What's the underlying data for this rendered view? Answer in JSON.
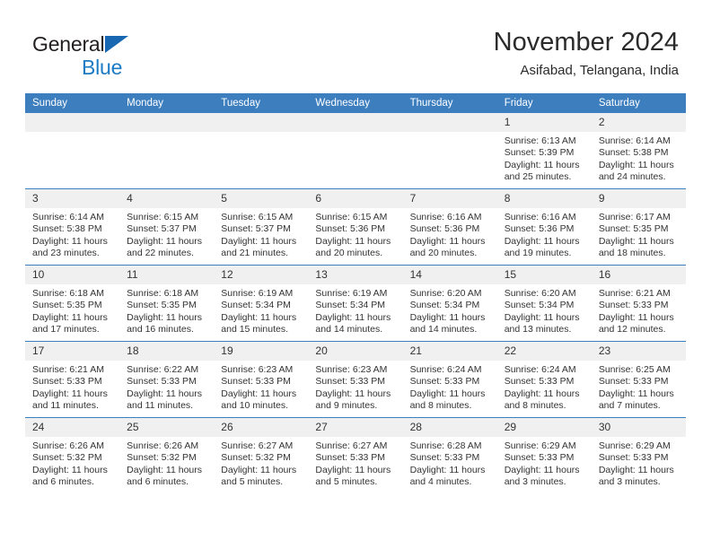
{
  "brand": {
    "word1": "General",
    "word2": "Blue",
    "triangle_color": "#1767b2",
    "blue_color": "#1b7ac4"
  },
  "header": {
    "title": "November 2024",
    "subtitle": "Asifabad, Telangana, India"
  },
  "theme": {
    "header_blue": "#3d7ebf",
    "daynum_gray": "#f0f0f0",
    "text": "#333333"
  },
  "weekday_headers": [
    "Sunday",
    "Monday",
    "Tuesday",
    "Wednesday",
    "Thursday",
    "Friday",
    "Saturday"
  ],
  "labels": {
    "sunrise": "Sunrise:",
    "sunset": "Sunset:",
    "daylight": "Daylight:"
  },
  "weeks": [
    [
      {
        "day": "",
        "empty": true
      },
      {
        "day": "",
        "empty": true
      },
      {
        "day": "",
        "empty": true
      },
      {
        "day": "",
        "empty": true
      },
      {
        "day": "",
        "empty": true
      },
      {
        "day": "1",
        "sunrise": "Sunrise: 6:13 AM",
        "sunset": "Sunset: 5:39 PM",
        "daylight": "Daylight: 11 hours and 25 minutes."
      },
      {
        "day": "2",
        "sunrise": "Sunrise: 6:14 AM",
        "sunset": "Sunset: 5:38 PM",
        "daylight": "Daylight: 11 hours and 24 minutes."
      }
    ],
    [
      {
        "day": "3",
        "sunrise": "Sunrise: 6:14 AM",
        "sunset": "Sunset: 5:38 PM",
        "daylight": "Daylight: 11 hours and 23 minutes."
      },
      {
        "day": "4",
        "sunrise": "Sunrise: 6:15 AM",
        "sunset": "Sunset: 5:37 PM",
        "daylight": "Daylight: 11 hours and 22 minutes."
      },
      {
        "day": "5",
        "sunrise": "Sunrise: 6:15 AM",
        "sunset": "Sunset: 5:37 PM",
        "daylight": "Daylight: 11 hours and 21 minutes."
      },
      {
        "day": "6",
        "sunrise": "Sunrise: 6:15 AM",
        "sunset": "Sunset: 5:36 PM",
        "daylight": "Daylight: 11 hours and 20 minutes."
      },
      {
        "day": "7",
        "sunrise": "Sunrise: 6:16 AM",
        "sunset": "Sunset: 5:36 PM",
        "daylight": "Daylight: 11 hours and 20 minutes."
      },
      {
        "day": "8",
        "sunrise": "Sunrise: 6:16 AM",
        "sunset": "Sunset: 5:36 PM",
        "daylight": "Daylight: 11 hours and 19 minutes."
      },
      {
        "day": "9",
        "sunrise": "Sunrise: 6:17 AM",
        "sunset": "Sunset: 5:35 PM",
        "daylight": "Daylight: 11 hours and 18 minutes."
      }
    ],
    [
      {
        "day": "10",
        "sunrise": "Sunrise: 6:18 AM",
        "sunset": "Sunset: 5:35 PM",
        "daylight": "Daylight: 11 hours and 17 minutes."
      },
      {
        "day": "11",
        "sunrise": "Sunrise: 6:18 AM",
        "sunset": "Sunset: 5:35 PM",
        "daylight": "Daylight: 11 hours and 16 minutes."
      },
      {
        "day": "12",
        "sunrise": "Sunrise: 6:19 AM",
        "sunset": "Sunset: 5:34 PM",
        "daylight": "Daylight: 11 hours and 15 minutes."
      },
      {
        "day": "13",
        "sunrise": "Sunrise: 6:19 AM",
        "sunset": "Sunset: 5:34 PM",
        "daylight": "Daylight: 11 hours and 14 minutes."
      },
      {
        "day": "14",
        "sunrise": "Sunrise: 6:20 AM",
        "sunset": "Sunset: 5:34 PM",
        "daylight": "Daylight: 11 hours and 14 minutes."
      },
      {
        "day": "15",
        "sunrise": "Sunrise: 6:20 AM",
        "sunset": "Sunset: 5:34 PM",
        "daylight": "Daylight: 11 hours and 13 minutes."
      },
      {
        "day": "16",
        "sunrise": "Sunrise: 6:21 AM",
        "sunset": "Sunset: 5:33 PM",
        "daylight": "Daylight: 11 hours and 12 minutes."
      }
    ],
    [
      {
        "day": "17",
        "sunrise": "Sunrise: 6:21 AM",
        "sunset": "Sunset: 5:33 PM",
        "daylight": "Daylight: 11 hours and 11 minutes."
      },
      {
        "day": "18",
        "sunrise": "Sunrise: 6:22 AM",
        "sunset": "Sunset: 5:33 PM",
        "daylight": "Daylight: 11 hours and 11 minutes."
      },
      {
        "day": "19",
        "sunrise": "Sunrise: 6:23 AM",
        "sunset": "Sunset: 5:33 PM",
        "daylight": "Daylight: 11 hours and 10 minutes."
      },
      {
        "day": "20",
        "sunrise": "Sunrise: 6:23 AM",
        "sunset": "Sunset: 5:33 PM",
        "daylight": "Daylight: 11 hours and 9 minutes."
      },
      {
        "day": "21",
        "sunrise": "Sunrise: 6:24 AM",
        "sunset": "Sunset: 5:33 PM",
        "daylight": "Daylight: 11 hours and 8 minutes."
      },
      {
        "day": "22",
        "sunrise": "Sunrise: 6:24 AM",
        "sunset": "Sunset: 5:33 PM",
        "daylight": "Daylight: 11 hours and 8 minutes."
      },
      {
        "day": "23",
        "sunrise": "Sunrise: 6:25 AM",
        "sunset": "Sunset: 5:33 PM",
        "daylight": "Daylight: 11 hours and 7 minutes."
      }
    ],
    [
      {
        "day": "24",
        "sunrise": "Sunrise: 6:26 AM",
        "sunset": "Sunset: 5:32 PM",
        "daylight": "Daylight: 11 hours and 6 minutes."
      },
      {
        "day": "25",
        "sunrise": "Sunrise: 6:26 AM",
        "sunset": "Sunset: 5:32 PM",
        "daylight": "Daylight: 11 hours and 6 minutes."
      },
      {
        "day": "26",
        "sunrise": "Sunrise: 6:27 AM",
        "sunset": "Sunset: 5:32 PM",
        "daylight": "Daylight: 11 hours and 5 minutes."
      },
      {
        "day": "27",
        "sunrise": "Sunrise: 6:27 AM",
        "sunset": "Sunset: 5:33 PM",
        "daylight": "Daylight: 11 hours and 5 minutes."
      },
      {
        "day": "28",
        "sunrise": "Sunrise: 6:28 AM",
        "sunset": "Sunset: 5:33 PM",
        "daylight": "Daylight: 11 hours and 4 minutes."
      },
      {
        "day": "29",
        "sunrise": "Sunrise: 6:29 AM",
        "sunset": "Sunset: 5:33 PM",
        "daylight": "Daylight: 11 hours and 3 minutes."
      },
      {
        "day": "30",
        "sunrise": "Sunrise: 6:29 AM",
        "sunset": "Sunset: 5:33 PM",
        "daylight": "Daylight: 11 hours and 3 minutes."
      }
    ]
  ]
}
